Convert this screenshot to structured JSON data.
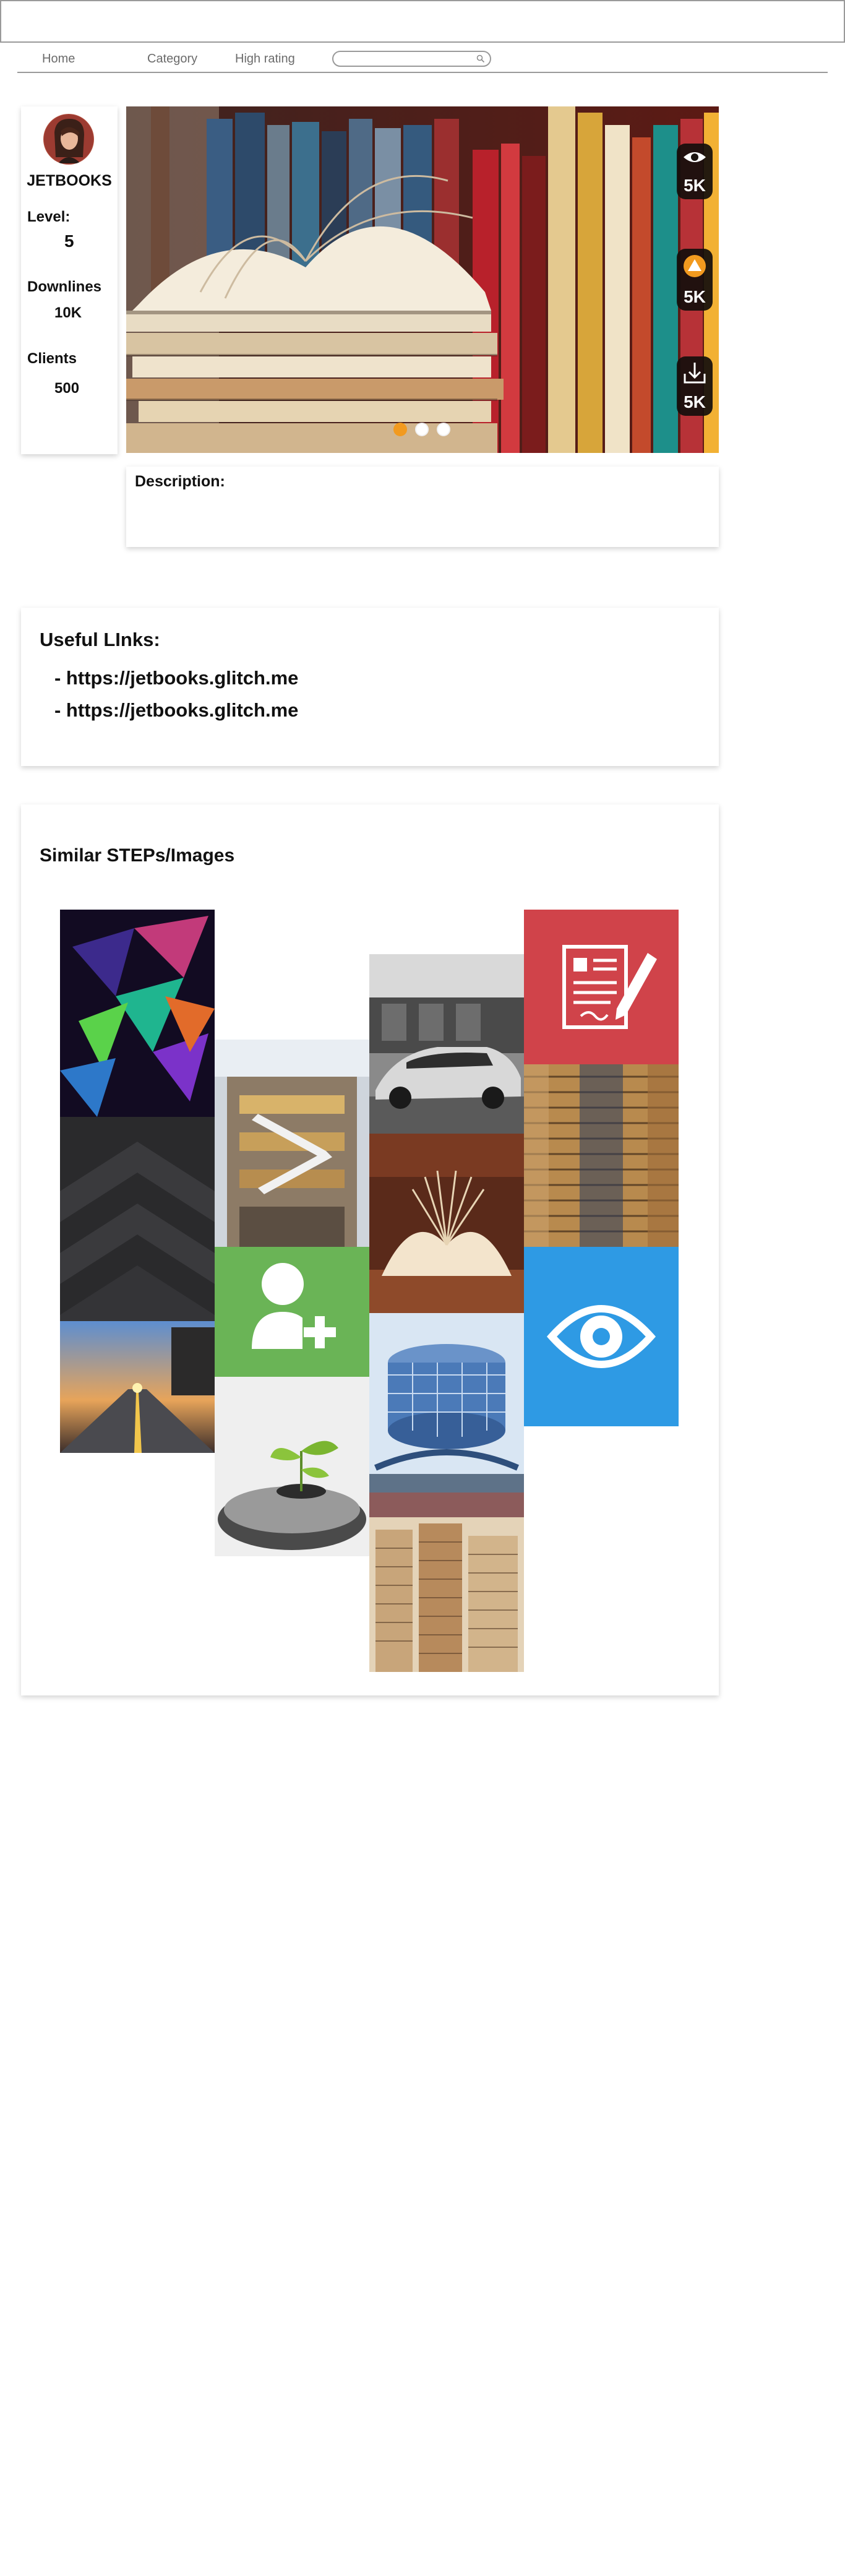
{
  "nav": {
    "home": "Home",
    "category": "Category",
    "high_rating": "High rating",
    "search_placeholder": ""
  },
  "profile": {
    "name": "JETBOOKS",
    "level_label": "Level:",
    "level_value": "5",
    "downlines_label": "Downlines",
    "downlines_value": "10K",
    "clients_label": "Clients",
    "clients_value": "500"
  },
  "hero": {
    "stats": [
      {
        "icon": "eye-icon",
        "value": "5K"
      },
      {
        "icon": "upvote-icon",
        "value": "5K"
      },
      {
        "icon": "download-icon",
        "value": "5K"
      }
    ],
    "carousel": {
      "slides": 3,
      "active": 1
    }
  },
  "description": {
    "label": "Description:",
    "text": ""
  },
  "useful_links": {
    "title": "Useful LInks:",
    "items": [
      "- https://jetbooks.glitch.me",
      "- https://jetbooks.glitch.me"
    ]
  },
  "similar": {
    "title": "Similar STEPs/Images",
    "tiles": [
      "abstract-polygons-image",
      "dark-chevron-image",
      "sunset-road-image",
      "shopping-mall-image",
      "add-user-icon",
      "plant-in-hand-image",
      "sports-car-image",
      "open-book-image",
      "glass-building-image",
      "book-stacks-image",
      "edit-document-icon",
      "book-piles-image",
      "eye-icon"
    ]
  },
  "colors": {
    "accent_orange": "#f29a1f",
    "tile_red": "#d0434a",
    "tile_green": "#6ab456",
    "tile_blue": "#2e9ae4"
  }
}
